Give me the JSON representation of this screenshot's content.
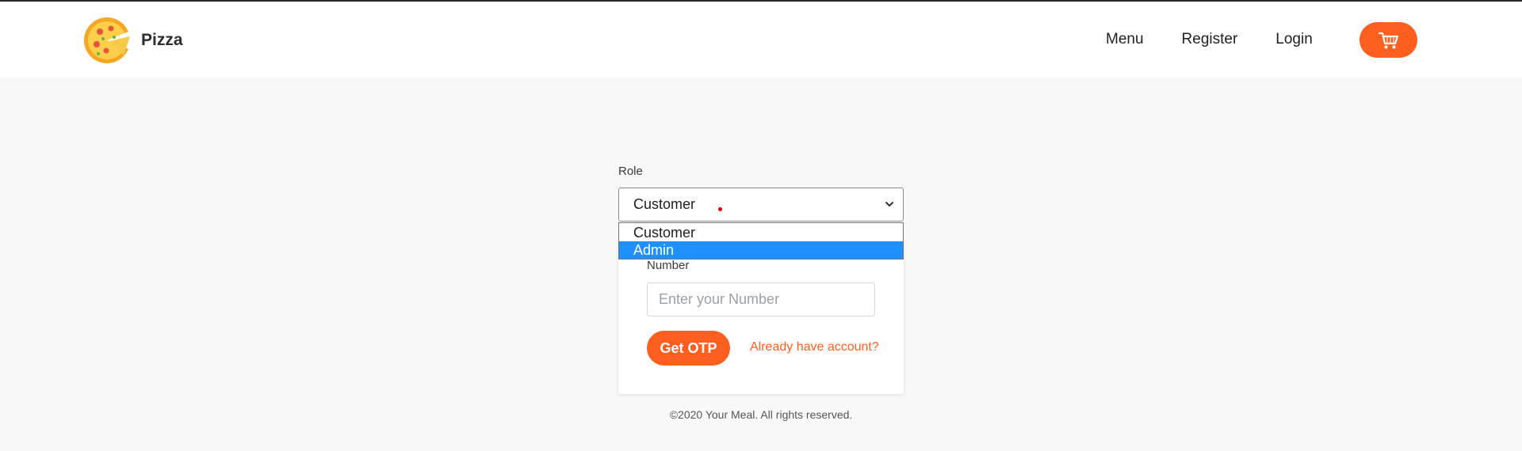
{
  "nav": {
    "brand": "Pizza",
    "links": [
      "Menu",
      "Register",
      "Login"
    ],
    "cart_icon": "cart-icon",
    "accent_color": "#fe5f1e"
  },
  "form": {
    "role_label": "Role",
    "role_selected": "Customer",
    "role_options": [
      "Customer",
      "Admin"
    ],
    "highlighted_option": "Admin",
    "number_label": "Number",
    "number_placeholder": "Enter your Number",
    "otp_button": "Get OTP",
    "account_link": "Already have account?"
  },
  "footer": {
    "text": "©2020 Your Meal. All rights reserved."
  }
}
